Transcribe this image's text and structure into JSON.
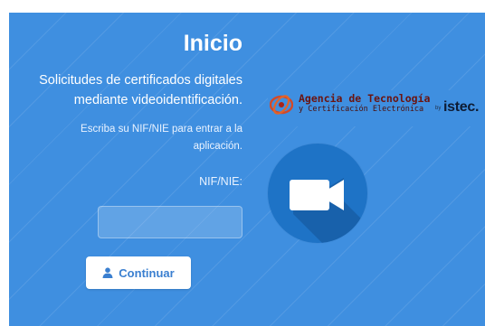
{
  "login": {
    "title": "Inicio",
    "subtitle": "Solicitudes de certificados digitales mediante videoidentificación.",
    "hint": "Escriba su NIF/NIE para entrar a la aplicación.",
    "field_label": "NIF/NIE:",
    "nif_value": "",
    "continue_label": "Continuar",
    "continue_icon": "user-icon"
  },
  "branding": {
    "agency_name": "Agencia de Tecnología",
    "agency_subtitle": "y Certificación Electrónica",
    "by_label": "by",
    "partner": "istec.",
    "hero_icon": "video-camera-icon"
  },
  "colors": {
    "background": "#3f8fe0",
    "button_text": "#3a7fd0",
    "circle": "#1e73c6",
    "agency_red": "#c0392b"
  }
}
